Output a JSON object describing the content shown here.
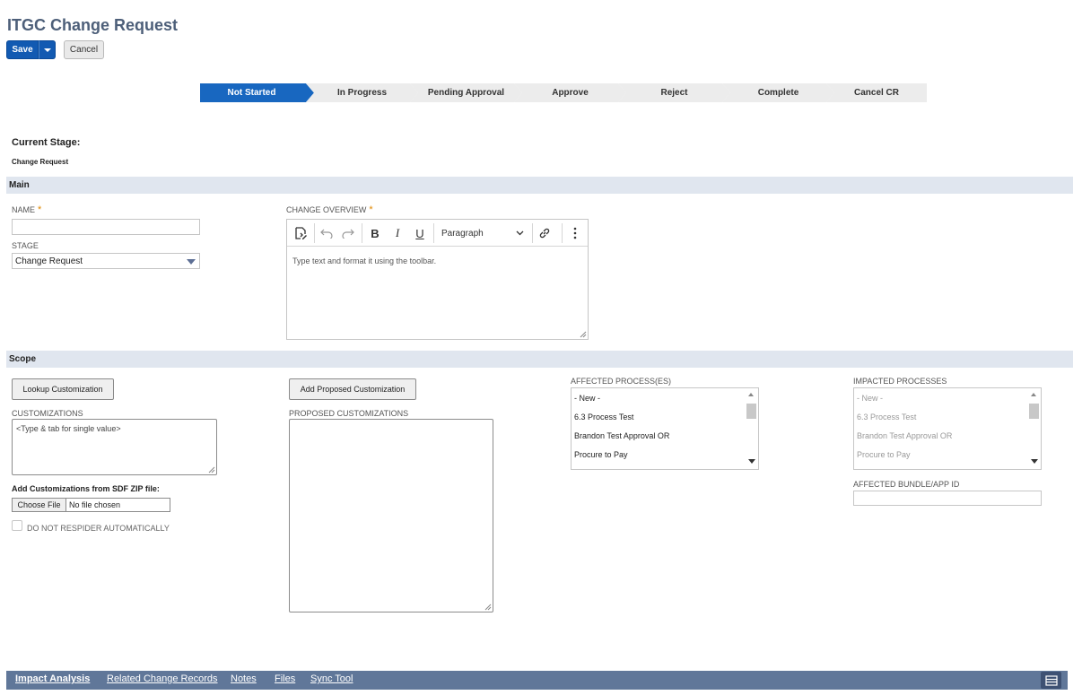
{
  "header": {
    "title": "ITGC Change Request",
    "save_label": "Save",
    "cancel_label": "Cancel"
  },
  "stages": [
    {
      "label": "Not Started",
      "active": true
    },
    {
      "label": "In Progress",
      "active": false
    },
    {
      "label": "Pending Approval",
      "active": false
    },
    {
      "label": "Approve",
      "active": false
    },
    {
      "label": "Reject",
      "active": false
    },
    {
      "label": "Complete",
      "active": false
    },
    {
      "label": "Cancel CR",
      "active": false
    }
  ],
  "current_stage": {
    "label": "Current Stage:",
    "value": "Change Request"
  },
  "main": {
    "section_title": "Main",
    "name_label": "NAME",
    "name_value": "",
    "stage_label": "STAGE",
    "stage_value": "Change Request",
    "overview_label": "CHANGE OVERVIEW",
    "required_mark": "*",
    "editor": {
      "block_format": "Paragraph",
      "placeholder": "Type text and format it using the toolbar."
    }
  },
  "scope": {
    "section_title": "Scope",
    "lookup_button": "Lookup Customization",
    "add_proposed_button": "Add Proposed Customization",
    "customizations_label": "CUSTOMIZATIONS",
    "customizations_placeholder": "<Type & tab for single value>",
    "proposed_label": "PROPOSED CUSTOMIZATIONS",
    "sdf_label": "Add Customizations from SDF ZIP file:",
    "choose_file_label": "Choose File",
    "no_file_text": "No file chosen",
    "respider_label": "DO NOT RESPIDER AUTOMATICALLY",
    "affected_label": "AFFECTED PROCESS(ES)",
    "affected_items": [
      "- New -",
      "6.3 Process Test",
      "Brandon Test Approval OR",
      "Procure to Pay"
    ],
    "impacted_label": "IMPACTED PROCESSES",
    "impacted_items": [
      "- New -",
      "6.3 Process Test",
      "Brandon Test Approval OR",
      "Procure to Pay"
    ],
    "bundle_label": "AFFECTED BUNDLE/APP ID",
    "bundle_value": ""
  },
  "tabs": [
    {
      "label": "Impact Analysis",
      "active": true
    },
    {
      "label": "Related Change Records",
      "active": false
    },
    {
      "label": "Notes",
      "active": false
    },
    {
      "label": "Files",
      "active": false
    },
    {
      "label": "Sync Tool",
      "active": false
    }
  ],
  "icons": {
    "save_menu": "chevron-down-icon",
    "editor_toolbar": [
      "ai-assist-icon",
      "undo-icon",
      "redo-icon",
      "bold-icon",
      "italic-icon",
      "underline-icon",
      "chevron-down-icon",
      "link-icon",
      "more-vertical-icon"
    ],
    "layout": "layout-rows-icon"
  },
  "colors": {
    "primary": "#125ab2",
    "active_stage": "#1867c0",
    "stage_bg": "#ececec",
    "section_bg": "#e0e6ef",
    "tabbar_bg": "#607799",
    "required": "#e08800"
  }
}
